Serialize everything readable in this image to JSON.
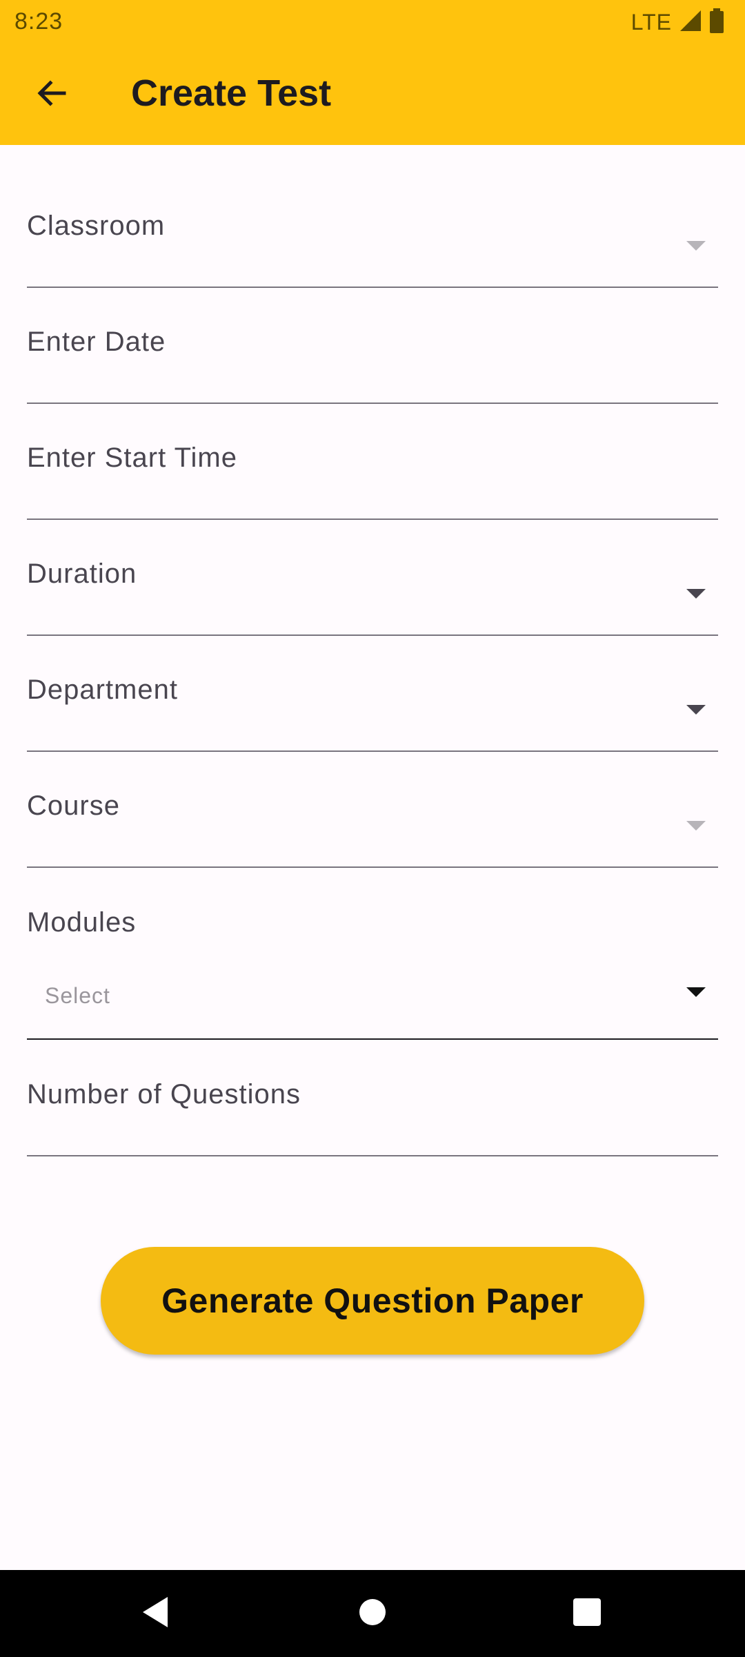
{
  "status_bar": {
    "time": "8:23",
    "network": "LTE",
    "icons": [
      "signal-icon",
      "battery-icon"
    ]
  },
  "app_bar": {
    "title": "Create Test",
    "back_icon": "arrow-back-icon"
  },
  "form": {
    "classroom_label": "Classroom",
    "date_label": "Enter Date",
    "start_time_label": "Enter Start Time",
    "duration_label": "Duration",
    "department_label": "Department",
    "course_label": "Course",
    "modules_label": "Modules",
    "modules_placeholder": "Select",
    "num_questions_label": "Number of Questions"
  },
  "actions": {
    "generate_label": "Generate Question Paper"
  },
  "colors": {
    "app_bar": "#FFC30D",
    "button": "#F4BB12",
    "background": "#FFFBFE"
  },
  "nav_bar": {
    "icons": [
      "back-triangle-icon",
      "home-circle-icon",
      "recents-square-icon"
    ]
  }
}
